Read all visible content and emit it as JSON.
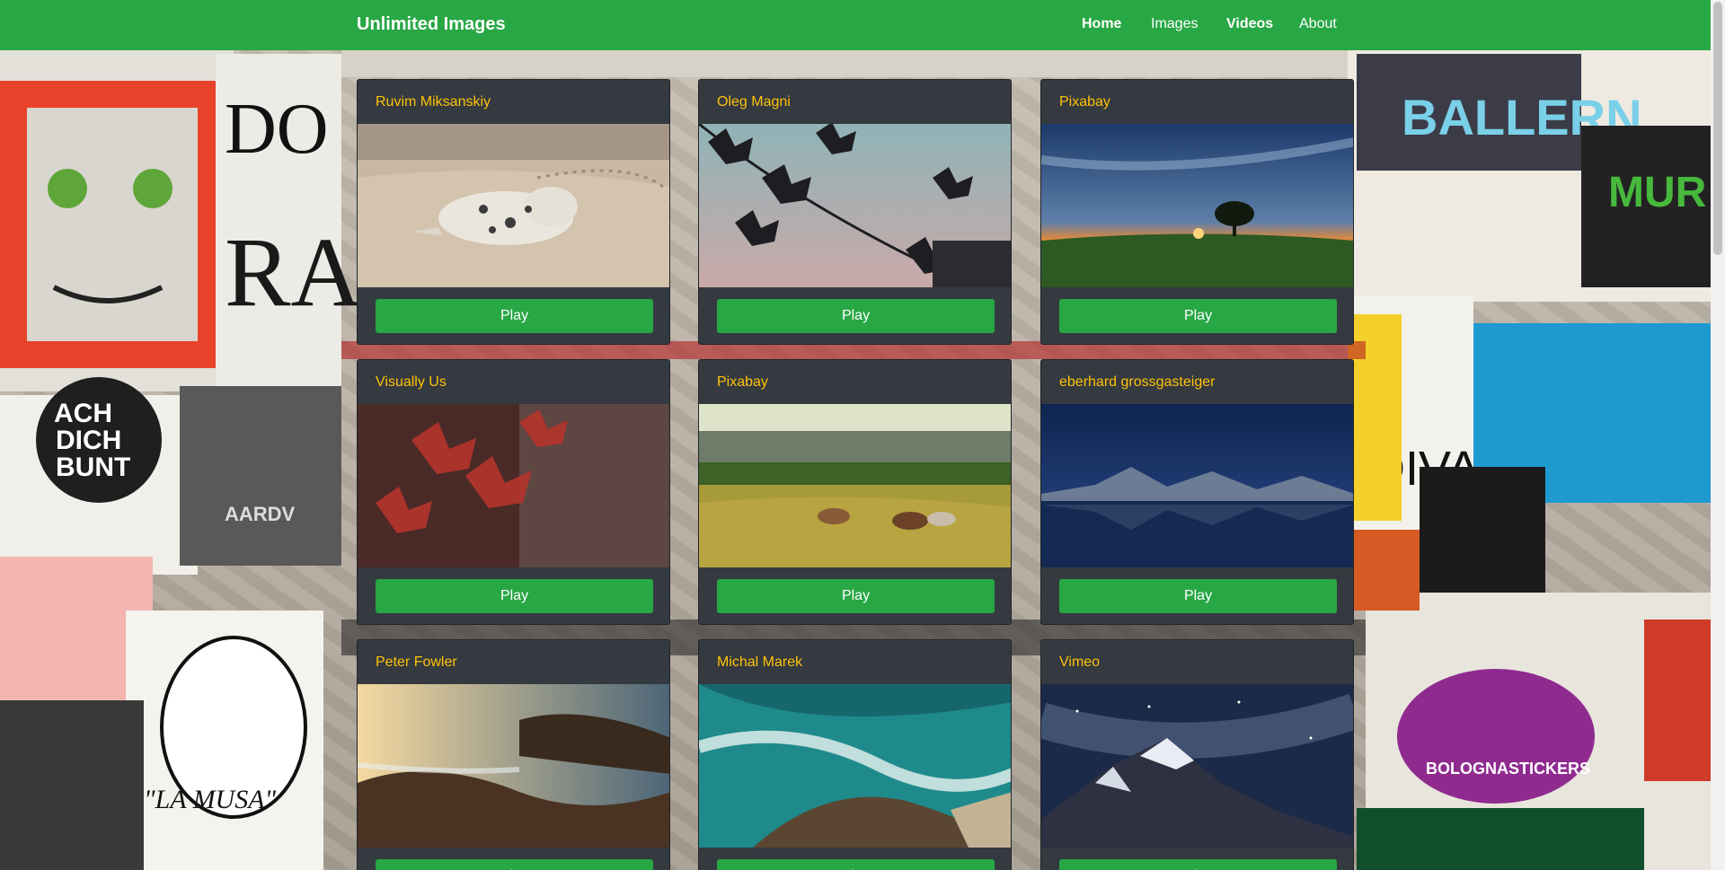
{
  "navbar": {
    "brand": "Unlimited Images",
    "links": [
      {
        "label": "Home",
        "bold": true
      },
      {
        "label": "Images",
        "bold": false
      },
      {
        "label": "Videos",
        "bold": true
      },
      {
        "label": "About",
        "bold": false
      }
    ]
  },
  "cards": [
    {
      "author": "Ruvim Miksanskiy",
      "button": "Play",
      "scene": "seal on sand beach"
    },
    {
      "author": "Oleg Magni",
      "button": "Play",
      "scene": "leaves silhouette at dusk"
    },
    {
      "author": "Pixabay",
      "button": "Play",
      "scene": "sunset over field with tree"
    },
    {
      "author": "Visually Us",
      "button": "Play",
      "scene": "red maple leaves"
    },
    {
      "author": "Pixabay",
      "button": "Play",
      "scene": "cows grazing in meadow"
    },
    {
      "author": "eberhard grossgasteiger",
      "button": "Play",
      "scene": "mountain lake at night"
    },
    {
      "author": "Peter Fowler",
      "button": "Play",
      "scene": "rocky coastline at sunrise"
    },
    {
      "author": "Michal Marek",
      "button": "Play",
      "scene": "aerial ocean waves on rocks"
    },
    {
      "author": "Vimeo",
      "button": "Play",
      "scene": "snowy mountain under milky way"
    }
  ],
  "colors": {
    "navbar": "#28a745",
    "card_bg": "#343a40",
    "author_text": "#ffc107",
    "button": "#28a745"
  }
}
